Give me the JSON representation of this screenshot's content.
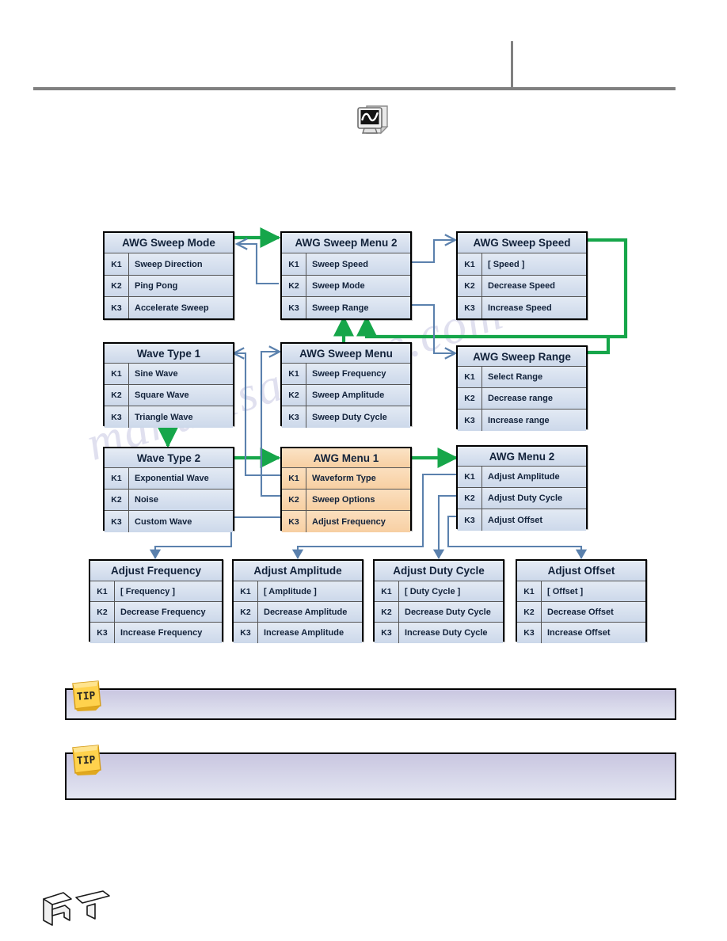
{
  "document": {
    "chapter_icon": "waveform-document-icon",
    "watermark_text": "manualsarchive.com",
    "footer_logo": "rt-logo"
  },
  "colors": {
    "box_fill": "#dbe4f0",
    "box_fill_highlight": "#fad9b4",
    "box_border": "#000000",
    "green_arrow": "#16a64a",
    "blue_arrow": "#5b81ad",
    "rule": "#808080",
    "tip_fill": "#c9c6e0",
    "note_yellow": "#ffd24d"
  },
  "diagram": {
    "type": "menu-navigation-flowchart",
    "boxes": [
      {
        "id": "awg-sweep-mode",
        "title": "AWG Sweep Mode",
        "highlight": false,
        "rows": [
          {
            "key": "K1",
            "label": "Sweep Direction"
          },
          {
            "key": "K2",
            "label": "Ping Pong"
          },
          {
            "key": "K3",
            "label": "Accelerate Sweep"
          }
        ]
      },
      {
        "id": "awg-sweep-menu-2",
        "title": "AWG Sweep Menu 2",
        "highlight": false,
        "rows": [
          {
            "key": "K1",
            "label": "Sweep Speed"
          },
          {
            "key": "K2",
            "label": "Sweep Mode"
          },
          {
            "key": "K3",
            "label": "Sweep Range"
          }
        ]
      },
      {
        "id": "awg-sweep-speed",
        "title": "AWG Sweep Speed",
        "highlight": false,
        "rows": [
          {
            "key": "K1",
            "label": "[ Speed ]"
          },
          {
            "key": "K2",
            "label": "Decrease Speed"
          },
          {
            "key": "K3",
            "label": "Increase Speed"
          }
        ]
      },
      {
        "id": "wave-type-1",
        "title": "Wave Type 1",
        "highlight": false,
        "rows": [
          {
            "key": "K1",
            "label": "Sine Wave"
          },
          {
            "key": "K2",
            "label": "Square Wave"
          },
          {
            "key": "K3",
            "label": "Triangle Wave"
          }
        ]
      },
      {
        "id": "awg-sweep-menu",
        "title": "AWG Sweep Menu",
        "highlight": false,
        "rows": [
          {
            "key": "K1",
            "label": "Sweep Frequency"
          },
          {
            "key": "K2",
            "label": "Sweep Amplitude"
          },
          {
            "key": "K3",
            "label": "Sweep Duty Cycle"
          }
        ]
      },
      {
        "id": "awg-sweep-range",
        "title": "AWG Sweep Range",
        "highlight": false,
        "rows": [
          {
            "key": "K1",
            "label": "Select Range"
          },
          {
            "key": "K2",
            "label": "Decrease range"
          },
          {
            "key": "K3",
            "label": "Increase range"
          }
        ]
      },
      {
        "id": "wave-type-2",
        "title": "Wave Type 2",
        "highlight": false,
        "rows": [
          {
            "key": "K1",
            "label": "Exponential Wave"
          },
          {
            "key": "K2",
            "label": "Noise"
          },
          {
            "key": "K3",
            "label": "Custom Wave"
          }
        ]
      },
      {
        "id": "awg-menu-1",
        "title": "AWG Menu 1",
        "highlight": true,
        "rows": [
          {
            "key": "K1",
            "label": "Waveform Type"
          },
          {
            "key": "K2",
            "label": "Sweep Options"
          },
          {
            "key": "K3",
            "label": "Adjust Frequency"
          }
        ]
      },
      {
        "id": "awg-menu-2",
        "title": "AWG Menu 2",
        "highlight": false,
        "rows": [
          {
            "key": "K1",
            "label": "Adjust Amplitude"
          },
          {
            "key": "K2",
            "label": "Adjust Duty Cycle"
          },
          {
            "key": "K3",
            "label": "Adjust Offset"
          }
        ]
      },
      {
        "id": "adjust-frequency",
        "title": "Adjust Frequency",
        "highlight": false,
        "rows": [
          {
            "key": "K1",
            "label": "[ Frequency ]"
          },
          {
            "key": "K2",
            "label": "Decrease Frequency"
          },
          {
            "key": "K3",
            "label": "Increase Frequency"
          }
        ]
      },
      {
        "id": "adjust-amplitude",
        "title": "Adjust Amplitude",
        "highlight": false,
        "rows": [
          {
            "key": "K1",
            "label": "[ Amplitude ]"
          },
          {
            "key": "K2",
            "label": "Decrease Amplitude"
          },
          {
            "key": "K3",
            "label": "Increase Amplitude"
          }
        ]
      },
      {
        "id": "adjust-duty-cycle",
        "title": "Adjust Duty Cycle",
        "highlight": false,
        "rows": [
          {
            "key": "K1",
            "label": "[ Duty Cycle ]"
          },
          {
            "key": "K2",
            "label": "Decrease Duty Cycle"
          },
          {
            "key": "K3",
            "label": "Increase Duty Cycle"
          }
        ]
      },
      {
        "id": "adjust-offset",
        "title": "Adjust Offset",
        "highlight": false,
        "rows": [
          {
            "key": "K1",
            "label": "[ Offset ]"
          },
          {
            "key": "K2",
            "label": "Decrease Offset"
          },
          {
            "key": "K3",
            "label": "Increase Offset"
          }
        ]
      }
    ]
  },
  "tips": [
    {
      "id": "tip-1",
      "badge": "TIP",
      "text": ""
    },
    {
      "id": "tip-2",
      "badge": "TIP",
      "text": ""
    }
  ]
}
